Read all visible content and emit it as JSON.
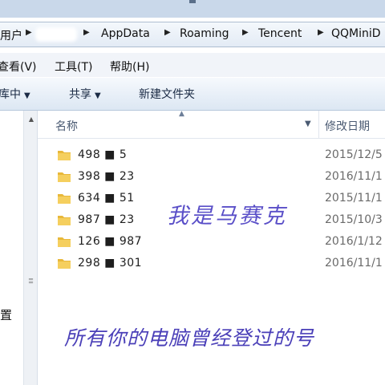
{
  "address_bar": {
    "crumbs": [
      "用户",
      "AppData",
      "Roaming",
      "Tencent",
      "QQMiniD"
    ]
  },
  "menu": {
    "view": "查看(V)",
    "tools": "工具(T)",
    "help": "帮助(H)"
  },
  "toolbar": {
    "include_in_library": "库中",
    "share": "共享",
    "new_folder": "新建文件夹"
  },
  "nav_pane": {
    "label": "置"
  },
  "columns": {
    "name": "名称",
    "date_modified": "修改日期"
  },
  "rows": [
    {
      "name": "498 ■ 5",
      "date": "2015/12/5"
    },
    {
      "name": "398 ■ 23",
      "date": "2016/11/1"
    },
    {
      "name": "634 ■ 51",
      "date": "2015/11/1"
    },
    {
      "name": "987 ■ 23",
      "date": "2015/10/3"
    },
    {
      "name": "126 ■ 987",
      "date": "2016/1/12"
    },
    {
      "name": "298 ■ 301",
      "date": "2016/11/1"
    }
  ],
  "overlay": {
    "watermark": "我是马赛克",
    "caption": "所有你的电脑曾经登过的号"
  },
  "colors": {
    "folder": "#e8b83a",
    "overlay_text": "#4a3fb8"
  }
}
